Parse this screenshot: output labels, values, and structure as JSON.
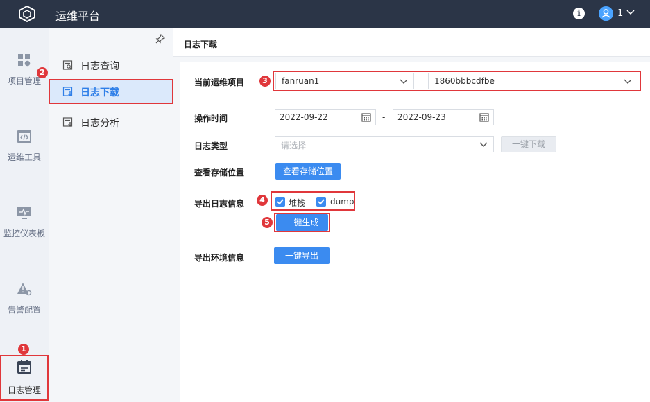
{
  "app": {
    "title": "运维平台",
    "info_icon": "i",
    "user_count": "1"
  },
  "rail": {
    "items": [
      {
        "label": "项目管理",
        "icon": "grid-icon"
      },
      {
        "label": "运维工具",
        "icon": "code-window-icon"
      },
      {
        "label": "监控仪表板",
        "icon": "monitor-icon"
      },
      {
        "label": "告警配置",
        "icon": "alert-settings-icon"
      },
      {
        "label": "日志管理",
        "icon": "calendar-log-icon"
      }
    ]
  },
  "subnav": {
    "items": [
      {
        "label": "日志查询"
      },
      {
        "label": "日志下载"
      },
      {
        "label": "日志分析"
      }
    ]
  },
  "page": {
    "title": "日志下载"
  },
  "form": {
    "project_label": "当前运维项目",
    "project_value": "fanruan1",
    "node_value": "1860bbbcdfbe",
    "time_label": "操作时间",
    "start_date": "2022-09-22",
    "date_separator": "-",
    "end_date": "2022-09-23",
    "type_label": "日志类型",
    "type_placeholder": "请选择",
    "one_click_download": "一键下载",
    "storage_label": "查看存储位置",
    "storage_button": "查看存储位置",
    "export_log_label": "导出日志信息",
    "checkbox_stack": "堆栈",
    "checkbox_dump": "dump",
    "generate_button": "一键生成",
    "export_env_label": "导出环境信息",
    "export_button": "一键导出"
  },
  "badges": [
    "1",
    "2",
    "3",
    "4",
    "5"
  ],
  "colors": {
    "accent": "#3b8bf0",
    "topbar": "#2b3547",
    "highlight": "#e0373b"
  }
}
